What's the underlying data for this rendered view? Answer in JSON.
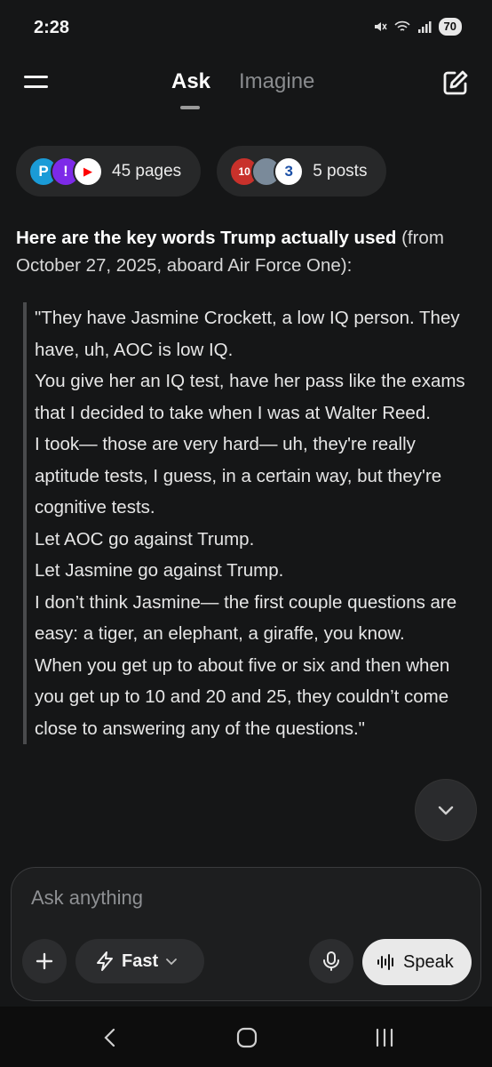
{
  "status_bar": {
    "time": "2:28",
    "battery": "70",
    "icons": [
      "mute-icon",
      "wifi-icon",
      "signal-icon",
      "battery-icon"
    ]
  },
  "header": {
    "tabs": [
      {
        "label": "Ask",
        "active": true
      },
      {
        "label": "Imagine",
        "active": false
      }
    ],
    "menu_icon": "hamburger-menu-icon",
    "edit_icon": "new-chat-edit-icon"
  },
  "sources": [
    {
      "label": "45 pages",
      "favicons": [
        "P",
        "!",
        "▶"
      ]
    },
    {
      "label": "5 posts",
      "favicons": [
        "10",
        "",
        "3"
      ]
    }
  ],
  "answer": {
    "lead_bold": "Here are the key words Trump actually used",
    "lead_rest": " (from October 27, 2025, aboard Air Force One):",
    "quote_lines": [
      "\"They have Jasmine Crockett, a low IQ person. They have, uh, AOC is low IQ.",
      "You give her an IQ test, have her pass like the exams that I decided to take when I was at Walter Reed.",
      "I took— those are very hard— uh, they're really aptitude tests, I guess, in a certain way, but they're cognitive tests.",
      "Let AOC go against Trump.",
      "Let Jasmine go against Trump.",
      "I don’t think Jasmine— the first couple questions are easy: a tiger, an elephant, a giraffe, you know.",
      "When you get up to about five or six and then when you get up to 10 and 20 and 25, they couldn’t come close to answering any of the questions.\""
    ]
  },
  "composer": {
    "placeholder": "Ask anything",
    "mode_label": "Fast",
    "speak_label": "Speak"
  },
  "colors": {
    "background": "#151617",
    "chip": "#272829",
    "speak_button": "#e9e9e9"
  }
}
